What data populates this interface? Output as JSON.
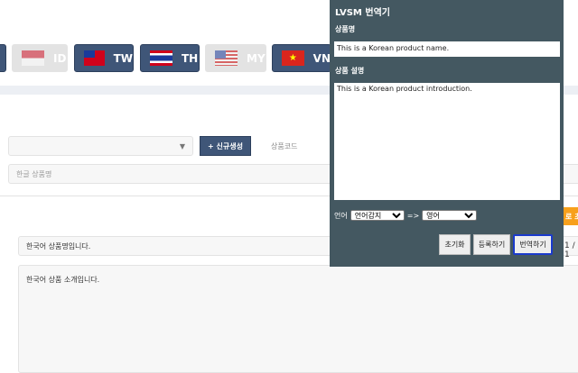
{
  "flags": [
    {
      "code": "ID",
      "active": false
    },
    {
      "code": "TW",
      "active": true
    },
    {
      "code": "TH",
      "active": true
    },
    {
      "code": "MY",
      "active": false
    },
    {
      "code": "VN",
      "active": true
    }
  ],
  "form": {
    "new_button": "+ 신규생성",
    "product_code_label": "상품코드",
    "korean_name_placeholder": "한글 상품명",
    "korean_name_value": "한국어 상품명입니다.",
    "korean_desc_value": "한국어 상품 소개입니다.",
    "page_indicator": "1 / 1",
    "orange_button_partial": "로 초"
  },
  "translator": {
    "title": "LVSM 번역기",
    "name_label": "상품명",
    "name_value": "This is a Korean product name.",
    "desc_label": "상품 설명",
    "desc_value": "This is a Korean product introduction.",
    "lang_label": "언어",
    "source_lang": "언어감지",
    "arrow": "=>",
    "target_lang": "영어",
    "reset_button": "초기화",
    "register_button": "등록하기",
    "translate_button": "번역하기"
  },
  "colors": {
    "panel": "#445861",
    "active_flag": "#3f5678",
    "orange": "#f7a01c"
  }
}
